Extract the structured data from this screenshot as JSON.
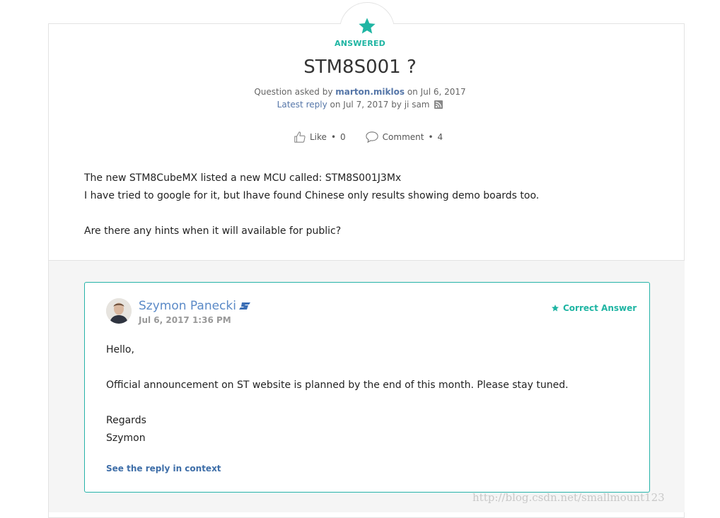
{
  "question": {
    "status": "ANSWERED",
    "title": "STM8S001 ?",
    "asked_prefix": "Question asked by",
    "asked_by": "marton.miklos",
    "asked_on": "on Jul 6, 2017",
    "latest_reply_label": "Latest reply",
    "latest_reply_info": "on Jul 7, 2017 by ji sam",
    "like_label": "Like",
    "like_count": "0",
    "comment_label": "Comment",
    "comment_count": "4",
    "body_lines": [
      "The new STM8CubeMX listed a new MCU called: STM8S001J3Mx",
      "I have tried to google for it, but Ihave found Chinese only results showing demo boards too.",
      "Are there any hints when it will available for public?"
    ]
  },
  "answer": {
    "author": "Szymon Panecki",
    "date": "Jul 6, 2017 1:36 PM",
    "badge": "Correct Answer",
    "lines": [
      "Hello,",
      "Official announcement on ST website is planned by the end of this month. Please stay tuned.",
      "Regards",
      "Szymon"
    ],
    "context_link": "See the reply in context"
  },
  "watermark": "http://blog.csdn.net/smallmount123",
  "colors": {
    "accent": "#1fb5a3",
    "link": "#5576a8",
    "border": "#26b3a9"
  }
}
